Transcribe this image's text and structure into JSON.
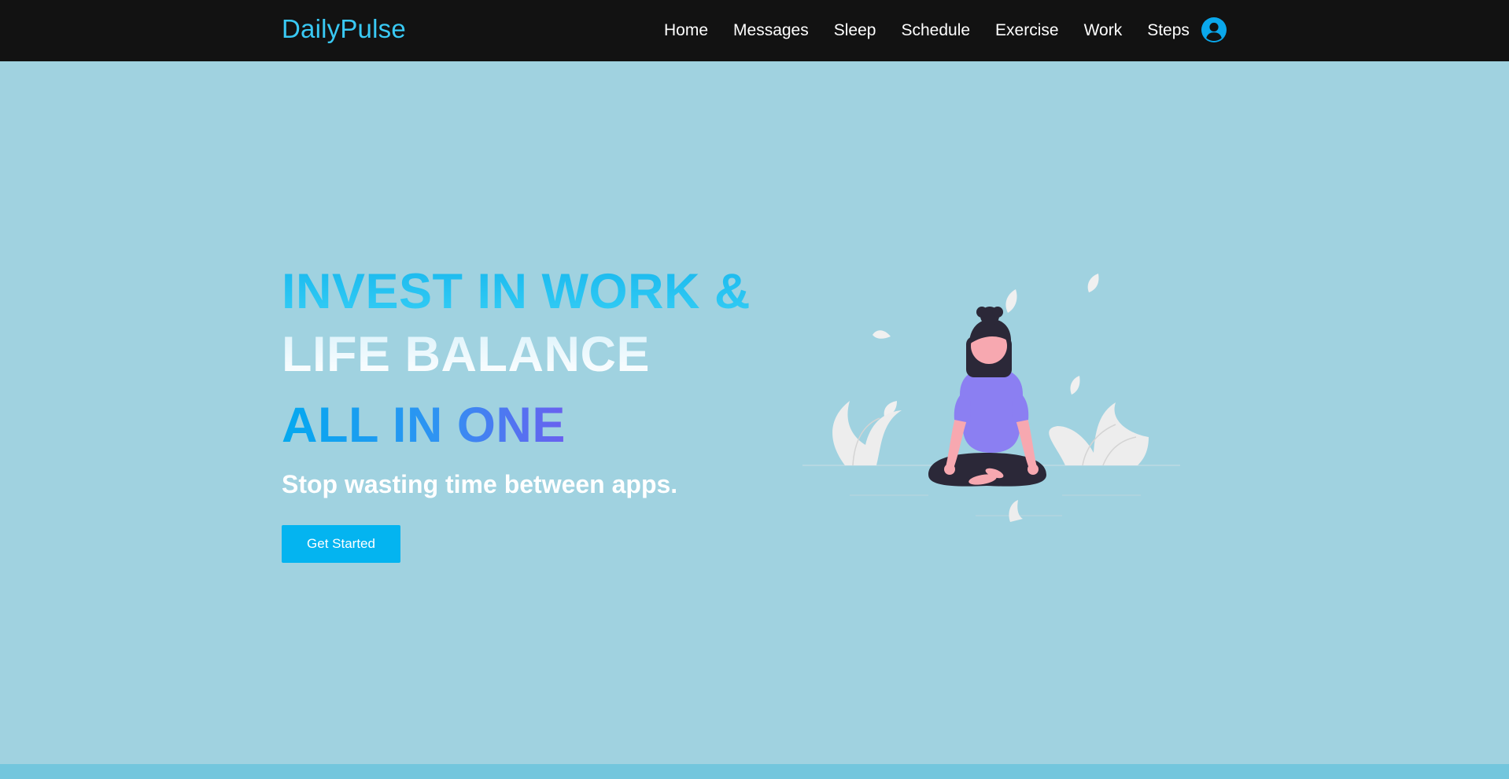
{
  "header": {
    "brand": "DailyPulse",
    "nav_items": [
      "Home",
      "Messages",
      "Sleep",
      "Schedule",
      "Exercise",
      "Work",
      "Steps"
    ],
    "user_icon": "user-circle-icon"
  },
  "hero": {
    "headline_line1": "INVEST IN WORK &",
    "headline_line2": "LIFE BALANCE",
    "headline_line3": "ALL IN ONE",
    "subheadline": "Stop wasting time between apps.",
    "cta_label": "Get Started",
    "illustration": "meditating-woman-illustration"
  },
  "colors": {
    "navbar_bg": "#121212",
    "brand": "#39c9f4",
    "hero_bg": "#a0d2e0",
    "accent": "#04b4f0",
    "footer_strip": "#73c6dd"
  }
}
